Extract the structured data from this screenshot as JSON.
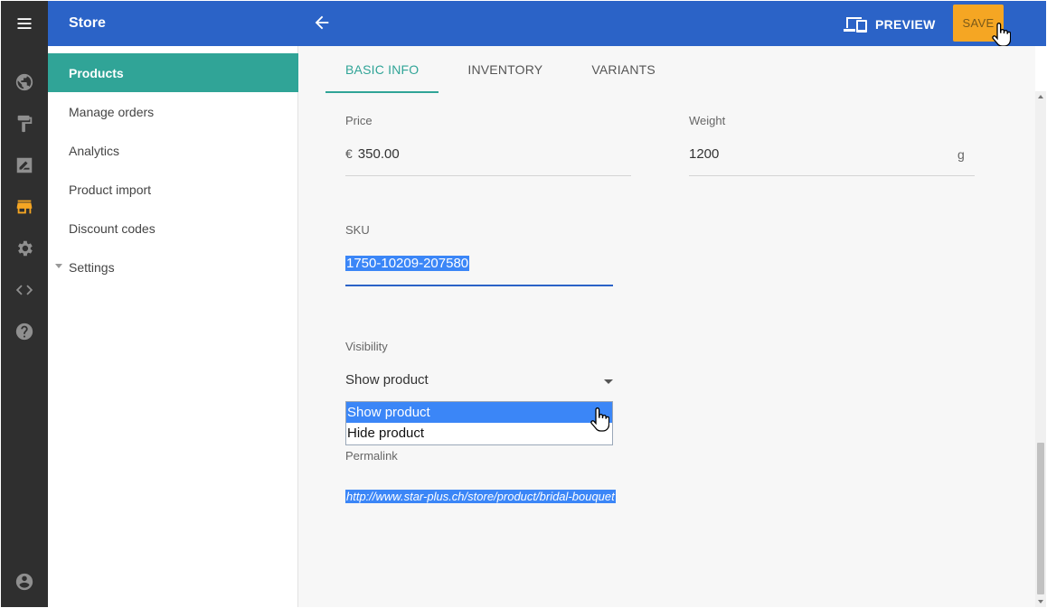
{
  "header": {
    "store_title": "Store",
    "preview_label": "PREVIEW",
    "save_label": "SAVE"
  },
  "rail": {
    "icons": [
      "menu-icon",
      "globe-icon",
      "paint-roller-icon",
      "signature-icon",
      "store-icon",
      "gear-icon",
      "code-icon",
      "help-icon",
      "account-icon"
    ],
    "active_icon": "store-icon"
  },
  "sidebar": {
    "items": [
      {
        "label": "Products",
        "active": true
      },
      {
        "label": "Manage orders"
      },
      {
        "label": "Analytics"
      },
      {
        "label": "Product import"
      },
      {
        "label": "Discount codes"
      },
      {
        "label": "Settings",
        "collapsible": true
      }
    ]
  },
  "tabs": [
    {
      "label": "BASIC INFO",
      "active": true
    },
    {
      "label": "INVENTORY"
    },
    {
      "label": "VARIANTS"
    }
  ],
  "form": {
    "price": {
      "label": "Price",
      "currency": "€",
      "value": "350.00"
    },
    "weight": {
      "label": "Weight",
      "value": "1200",
      "unit": "g"
    },
    "sku": {
      "label": "SKU",
      "value": "1750-10209-207580"
    },
    "visibility": {
      "label": "Visibility",
      "value": "Show product",
      "options": [
        "Show product",
        "Hide product"
      ],
      "highlighted": "Show product"
    },
    "permalink": {
      "label": "Permalink",
      "value": "http://www.star-plus.ch/store/product/bridal-bouquet"
    }
  },
  "colors": {
    "header_bg": "#2b63c7",
    "accent_teal": "#30a497",
    "save_bg": "#f5a623",
    "rail_bg": "#2f2f2f",
    "selection": "#3b86f7"
  }
}
